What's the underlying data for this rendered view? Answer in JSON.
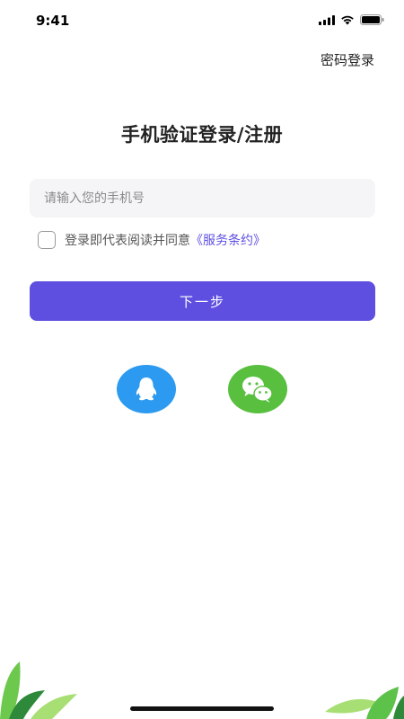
{
  "status_bar": {
    "time": "9:41",
    "icons": [
      "cellular-signal-icon",
      "wifi-icon",
      "battery-icon"
    ]
  },
  "header": {
    "password_login_link": "密码登录"
  },
  "main": {
    "title": "手机验证登录/注册",
    "phone_input": {
      "placeholder": "请输入您的手机号",
      "value": ""
    },
    "agreement": {
      "checked": false,
      "text": "登录即代表阅读并同意",
      "link_text": "《服务条约》"
    },
    "next_button_label": "下一步",
    "social_logins": [
      {
        "name": "qq",
        "icon": "qq-penguin-icon",
        "color": "#2c9af0"
      },
      {
        "name": "wechat",
        "icon": "wechat-icon",
        "color": "#58bf3f"
      }
    ]
  },
  "colors": {
    "accent": "#5e4fe0",
    "input_bg": "#f5f5f7",
    "leaf_green": "#5cc24a"
  }
}
